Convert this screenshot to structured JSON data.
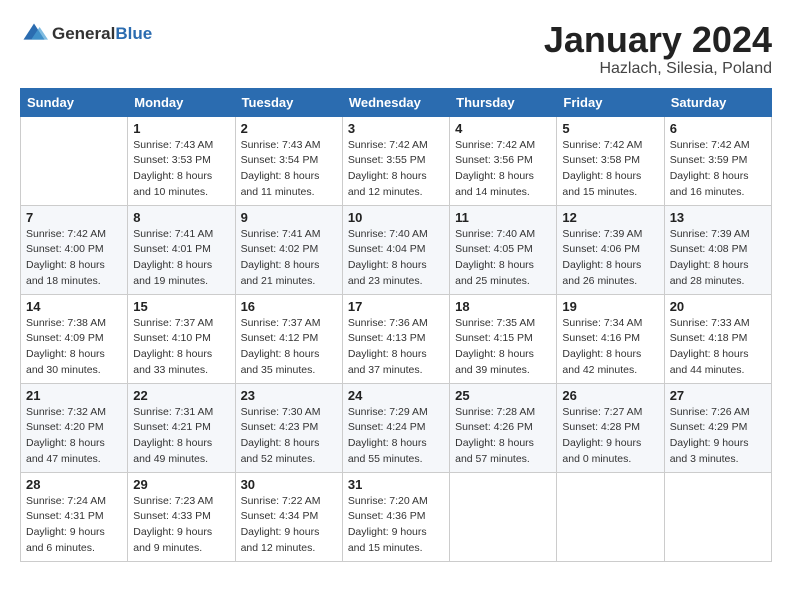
{
  "header": {
    "logo_general": "General",
    "logo_blue": "Blue",
    "title": "January 2024",
    "subtitle": "Hazlach, Silesia, Poland"
  },
  "weekdays": [
    "Sunday",
    "Monday",
    "Tuesday",
    "Wednesday",
    "Thursday",
    "Friday",
    "Saturday"
  ],
  "weeks": [
    [
      {
        "day": "",
        "sunrise": "",
        "sunset": "",
        "daylight": ""
      },
      {
        "day": "1",
        "sunrise": "Sunrise: 7:43 AM",
        "sunset": "Sunset: 3:53 PM",
        "daylight": "Daylight: 8 hours and 10 minutes."
      },
      {
        "day": "2",
        "sunrise": "Sunrise: 7:43 AM",
        "sunset": "Sunset: 3:54 PM",
        "daylight": "Daylight: 8 hours and 11 minutes."
      },
      {
        "day": "3",
        "sunrise": "Sunrise: 7:42 AM",
        "sunset": "Sunset: 3:55 PM",
        "daylight": "Daylight: 8 hours and 12 minutes."
      },
      {
        "day": "4",
        "sunrise": "Sunrise: 7:42 AM",
        "sunset": "Sunset: 3:56 PM",
        "daylight": "Daylight: 8 hours and 14 minutes."
      },
      {
        "day": "5",
        "sunrise": "Sunrise: 7:42 AM",
        "sunset": "Sunset: 3:58 PM",
        "daylight": "Daylight: 8 hours and 15 minutes."
      },
      {
        "day": "6",
        "sunrise": "Sunrise: 7:42 AM",
        "sunset": "Sunset: 3:59 PM",
        "daylight": "Daylight: 8 hours and 16 minutes."
      }
    ],
    [
      {
        "day": "7",
        "sunrise": "Sunrise: 7:42 AM",
        "sunset": "Sunset: 4:00 PM",
        "daylight": "Daylight: 8 hours and 18 minutes."
      },
      {
        "day": "8",
        "sunrise": "Sunrise: 7:41 AM",
        "sunset": "Sunset: 4:01 PM",
        "daylight": "Daylight: 8 hours and 19 minutes."
      },
      {
        "day": "9",
        "sunrise": "Sunrise: 7:41 AM",
        "sunset": "Sunset: 4:02 PM",
        "daylight": "Daylight: 8 hours and 21 minutes."
      },
      {
        "day": "10",
        "sunrise": "Sunrise: 7:40 AM",
        "sunset": "Sunset: 4:04 PM",
        "daylight": "Daylight: 8 hours and 23 minutes."
      },
      {
        "day": "11",
        "sunrise": "Sunrise: 7:40 AM",
        "sunset": "Sunset: 4:05 PM",
        "daylight": "Daylight: 8 hours and 25 minutes."
      },
      {
        "day": "12",
        "sunrise": "Sunrise: 7:39 AM",
        "sunset": "Sunset: 4:06 PM",
        "daylight": "Daylight: 8 hours and 26 minutes."
      },
      {
        "day": "13",
        "sunrise": "Sunrise: 7:39 AM",
        "sunset": "Sunset: 4:08 PM",
        "daylight": "Daylight: 8 hours and 28 minutes."
      }
    ],
    [
      {
        "day": "14",
        "sunrise": "Sunrise: 7:38 AM",
        "sunset": "Sunset: 4:09 PM",
        "daylight": "Daylight: 8 hours and 30 minutes."
      },
      {
        "day": "15",
        "sunrise": "Sunrise: 7:37 AM",
        "sunset": "Sunset: 4:10 PM",
        "daylight": "Daylight: 8 hours and 33 minutes."
      },
      {
        "day": "16",
        "sunrise": "Sunrise: 7:37 AM",
        "sunset": "Sunset: 4:12 PM",
        "daylight": "Daylight: 8 hours and 35 minutes."
      },
      {
        "day": "17",
        "sunrise": "Sunrise: 7:36 AM",
        "sunset": "Sunset: 4:13 PM",
        "daylight": "Daylight: 8 hours and 37 minutes."
      },
      {
        "day": "18",
        "sunrise": "Sunrise: 7:35 AM",
        "sunset": "Sunset: 4:15 PM",
        "daylight": "Daylight: 8 hours and 39 minutes."
      },
      {
        "day": "19",
        "sunrise": "Sunrise: 7:34 AM",
        "sunset": "Sunset: 4:16 PM",
        "daylight": "Daylight: 8 hours and 42 minutes."
      },
      {
        "day": "20",
        "sunrise": "Sunrise: 7:33 AM",
        "sunset": "Sunset: 4:18 PM",
        "daylight": "Daylight: 8 hours and 44 minutes."
      }
    ],
    [
      {
        "day": "21",
        "sunrise": "Sunrise: 7:32 AM",
        "sunset": "Sunset: 4:20 PM",
        "daylight": "Daylight: 8 hours and 47 minutes."
      },
      {
        "day": "22",
        "sunrise": "Sunrise: 7:31 AM",
        "sunset": "Sunset: 4:21 PM",
        "daylight": "Daylight: 8 hours and 49 minutes."
      },
      {
        "day": "23",
        "sunrise": "Sunrise: 7:30 AM",
        "sunset": "Sunset: 4:23 PM",
        "daylight": "Daylight: 8 hours and 52 minutes."
      },
      {
        "day": "24",
        "sunrise": "Sunrise: 7:29 AM",
        "sunset": "Sunset: 4:24 PM",
        "daylight": "Daylight: 8 hours and 55 minutes."
      },
      {
        "day": "25",
        "sunrise": "Sunrise: 7:28 AM",
        "sunset": "Sunset: 4:26 PM",
        "daylight": "Daylight: 8 hours and 57 minutes."
      },
      {
        "day": "26",
        "sunrise": "Sunrise: 7:27 AM",
        "sunset": "Sunset: 4:28 PM",
        "daylight": "Daylight: 9 hours and 0 minutes."
      },
      {
        "day": "27",
        "sunrise": "Sunrise: 7:26 AM",
        "sunset": "Sunset: 4:29 PM",
        "daylight": "Daylight: 9 hours and 3 minutes."
      }
    ],
    [
      {
        "day": "28",
        "sunrise": "Sunrise: 7:24 AM",
        "sunset": "Sunset: 4:31 PM",
        "daylight": "Daylight: 9 hours and 6 minutes."
      },
      {
        "day": "29",
        "sunrise": "Sunrise: 7:23 AM",
        "sunset": "Sunset: 4:33 PM",
        "daylight": "Daylight: 9 hours and 9 minutes."
      },
      {
        "day": "30",
        "sunrise": "Sunrise: 7:22 AM",
        "sunset": "Sunset: 4:34 PM",
        "daylight": "Daylight: 9 hours and 12 minutes."
      },
      {
        "day": "31",
        "sunrise": "Sunrise: 7:20 AM",
        "sunset": "Sunset: 4:36 PM",
        "daylight": "Daylight: 9 hours and 15 minutes."
      },
      {
        "day": "",
        "sunrise": "",
        "sunset": "",
        "daylight": ""
      },
      {
        "day": "",
        "sunrise": "",
        "sunset": "",
        "daylight": ""
      },
      {
        "day": "",
        "sunrise": "",
        "sunset": "",
        "daylight": ""
      }
    ]
  ]
}
